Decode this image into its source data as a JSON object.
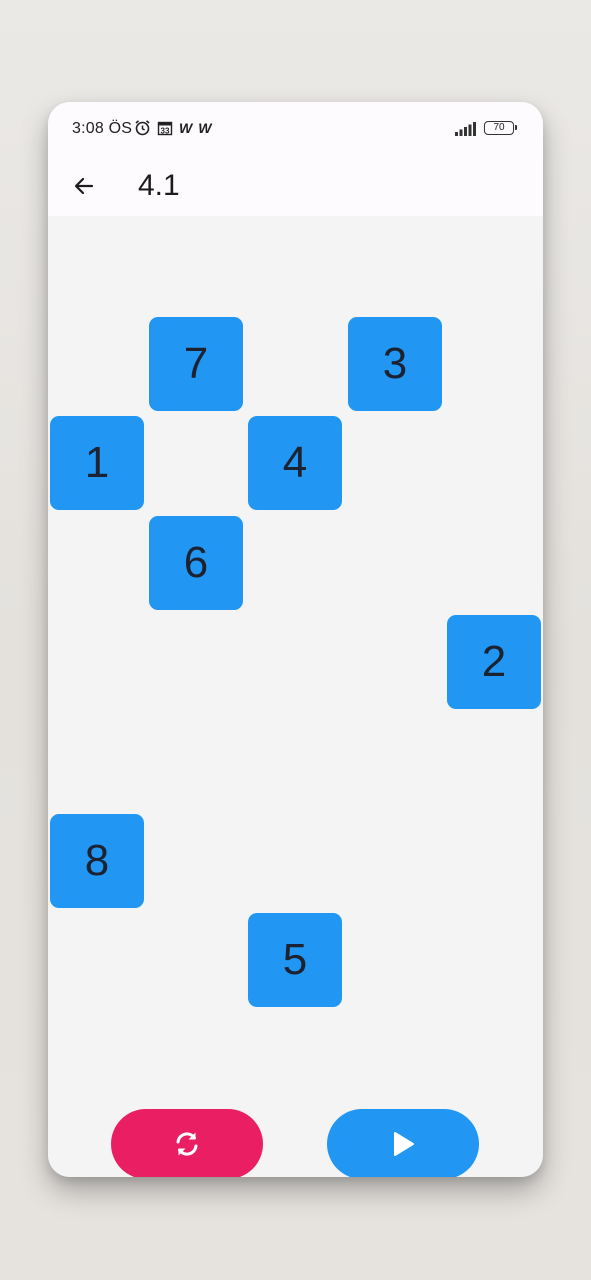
{
  "status": {
    "time": "3:08 ÖS",
    "icons": [
      "alarm-icon",
      "calendar-icon",
      "w-icon",
      "w-icon"
    ],
    "battery": "70"
  },
  "appbar": {
    "title": "4.1",
    "back_icon": "arrow-left-icon"
  },
  "tiles": [
    {
      "label": "7"
    },
    {
      "label": "3"
    },
    {
      "label": "1"
    },
    {
      "label": "4"
    },
    {
      "label": "6"
    },
    {
      "label": "2"
    },
    {
      "label": "8"
    },
    {
      "label": "5"
    }
  ],
  "buttons": {
    "reset_icon": "refresh-icon",
    "play_icon": "play-icon"
  },
  "colors": {
    "tile": "#2196f3",
    "reset": "#e91e63",
    "play": "#2196f3"
  }
}
